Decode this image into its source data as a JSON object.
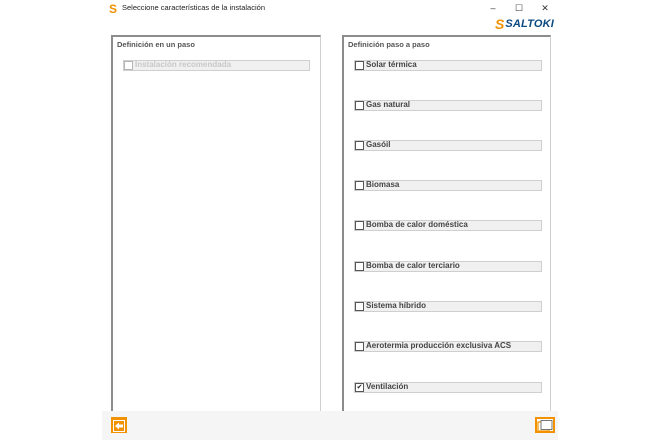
{
  "window": {
    "title": "Seleccione características de la instalación",
    "app_icon": "S",
    "minimize_glyph": "–",
    "maximize_glyph": "☐",
    "close_glyph": "✕"
  },
  "logo": {
    "mark": "S",
    "text": "SALTOKI"
  },
  "left_panel": {
    "title": "Definición en un paso",
    "options": [
      {
        "label": "Instalación recomendada",
        "checked": false,
        "enabled": false
      }
    ]
  },
  "right_panel": {
    "title": "Definición paso a paso",
    "options": [
      {
        "label": "Solar térmica",
        "checked": false
      },
      {
        "label": "Gas natural",
        "checked": false
      },
      {
        "label": "Gasóil",
        "checked": false
      },
      {
        "label": "Biomasa",
        "checked": false
      },
      {
        "label": "Bomba de calor doméstica",
        "checked": false
      },
      {
        "label": "Bomba de calor terciario",
        "checked": false
      },
      {
        "label": "Sistema híbrido",
        "checked": false
      },
      {
        "label": "Aerotermia producción exclusiva ACS",
        "checked": false
      },
      {
        "label": "Ventilación",
        "checked": true
      }
    ]
  },
  "footer": {
    "back_icon": "arrow-left-icon",
    "next_icon": "next-page-icon"
  },
  "colors": {
    "accent": "#f39200",
    "brand_blue": "#0a4a82"
  }
}
